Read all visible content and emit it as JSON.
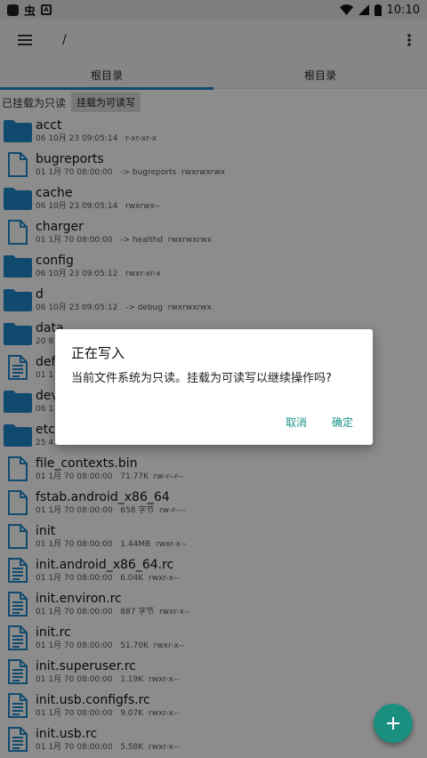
{
  "status_bar": {
    "time": "10:10"
  },
  "toolbar": {
    "path": "/"
  },
  "tabs": [
    {
      "label": "根目录"
    },
    {
      "label": "根目录"
    }
  ],
  "mount": {
    "status_text": "已挂载为只读",
    "button_label": "挂载为可读写"
  },
  "files": [
    {
      "name": "acct",
      "meta": "06 10月 23 09:05:14   r-xr-xr-x",
      "icon": "folder-icon"
    },
    {
      "name": "bugreports",
      "meta": "01 1月 70 08:00:00   -> bugreports  rwxrwxrwx",
      "icon": "file-icon"
    },
    {
      "name": "cache",
      "meta": "06 10月 23 09:05:14   rwxrwx--",
      "icon": "folder-icon"
    },
    {
      "name": "charger",
      "meta": "01 1月 70 08:00:00   -> healthd  rwxrwxrwx",
      "icon": "file-icon"
    },
    {
      "name": "config",
      "meta": "06 10月 23 09:05:12   rwxr-xr-x",
      "icon": "folder-icon"
    },
    {
      "name": "d",
      "meta": "06 10月 23 09:05:12   -> debug  rwxrwxrwx",
      "icon": "folder-icon"
    },
    {
      "name": "data",
      "meta": "20 8",
      "icon": "folder-icon"
    },
    {
      "name": "def",
      "meta": "01 1",
      "icon": "text-file-icon"
    },
    {
      "name": "dev",
      "meta": "06 1",
      "icon": "folder-icon"
    },
    {
      "name": "etc",
      "meta": "25 4",
      "icon": "folder-icon"
    },
    {
      "name": "file_contexts.bin",
      "meta": "01 1月 70 08:00:00   71.77K  rw-r--r--",
      "icon": "file-icon"
    },
    {
      "name": "fstab.android_x86_64",
      "meta": "01 1月 70 08:00:00   658 字节  rw-r----",
      "icon": "file-icon"
    },
    {
      "name": "init",
      "meta": "01 1月 70 08:00:00   1.44MB  rwxr-x--",
      "icon": "file-icon"
    },
    {
      "name": "init.android_x86_64.rc",
      "meta": "01 1月 70 08:00:00   6.04K  rwxr-x--",
      "icon": "text-file-icon"
    },
    {
      "name": "init.environ.rc",
      "meta": "01 1月 70 08:00:00   887 字节  rwxr-x--",
      "icon": "text-file-icon"
    },
    {
      "name": "init.rc",
      "meta": "01 1月 70 08:00:00   51.70K  rwxr-x--",
      "icon": "text-file-icon"
    },
    {
      "name": "init.superuser.rc",
      "meta": "01 1月 70 08:00:00   1.19K  rwxr-x--",
      "icon": "text-file-icon"
    },
    {
      "name": "init.usb.configfs.rc",
      "meta": "01 1月 70 08:00:00   9.07K  rwxr-x--",
      "icon": "text-file-icon"
    },
    {
      "name": "init.usb.rc",
      "meta": "01 1月 70 08:00:00   5.58K  rwxr-x--",
      "icon": "text-file-icon"
    }
  ],
  "dialog": {
    "title": "正在写入",
    "message": "当前文件系统为只读。挂载为可读写以继续操作吗?",
    "cancel_label": "取消",
    "ok_label": "确定"
  },
  "colors": {
    "accent": "#1e88c8",
    "folder": "#1e88c8",
    "fab": "#1a8f80",
    "dialog_button": "#1a9187"
  }
}
